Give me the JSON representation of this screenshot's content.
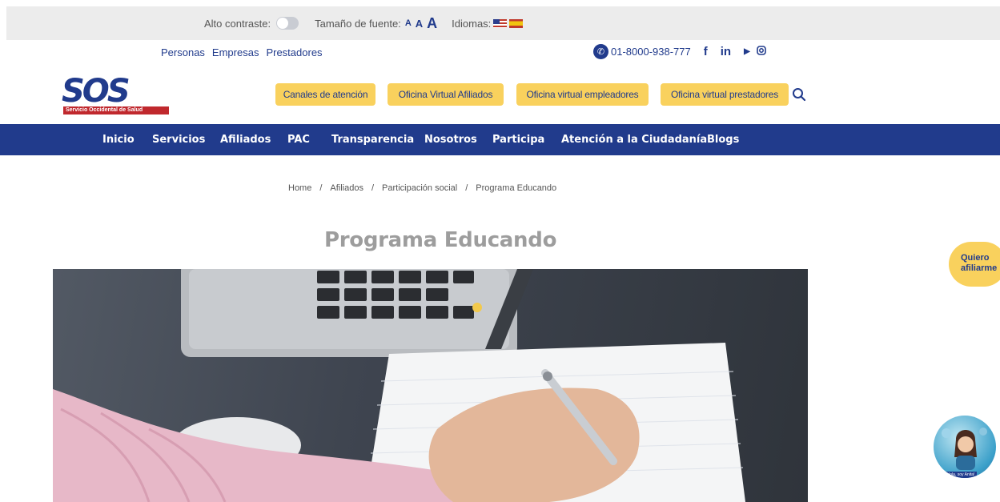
{
  "topbar": {
    "contrast_label": "Alto contraste:",
    "font_size_label": "Tamaño de fuente:",
    "font_sizes": [
      "A",
      "A",
      "A"
    ],
    "languages_label": "Idiomas:",
    "languages": [
      "english-flag-icon",
      "spanish-flag-icon"
    ]
  },
  "secnav": {
    "links": [
      "Personas",
      "Empresas",
      "Prestadores"
    ],
    "phone": "01-8000-938-777",
    "social": [
      "facebook-icon",
      "linkedin-icon",
      "youtube-icon",
      "instagram-icon"
    ]
  },
  "header": {
    "logo_text": "SOS",
    "logo_tagline": "Servicio Occidental de Salud",
    "buttons": [
      "Canales de atención",
      "Oficina Virtual Afiliados",
      "Oficina virtual empleadores",
      "Oficina virtual prestadores"
    ]
  },
  "mainnav": {
    "items": [
      "Inicio",
      "Servicios",
      "Afiliados",
      "PAC",
      "Transparencia",
      "Nosotros",
      "Participa",
      "Atención a la Ciudadanía",
      "Blogs"
    ]
  },
  "breadcrumb": {
    "items": [
      "Home",
      "Afiliados",
      "Participación social",
      "Programa Educando"
    ],
    "separator": "/"
  },
  "page": {
    "title": "Programa Educando"
  },
  "floating": {
    "cta_line1": "Quiero",
    "cta_line2": "afiliarme",
    "assistant_caption": "¡Hola, soy Anita!"
  },
  "colors": {
    "brand_blue": "#213b8c",
    "accent_yellow": "#f9d15d",
    "brand_red": "#c0282d"
  }
}
